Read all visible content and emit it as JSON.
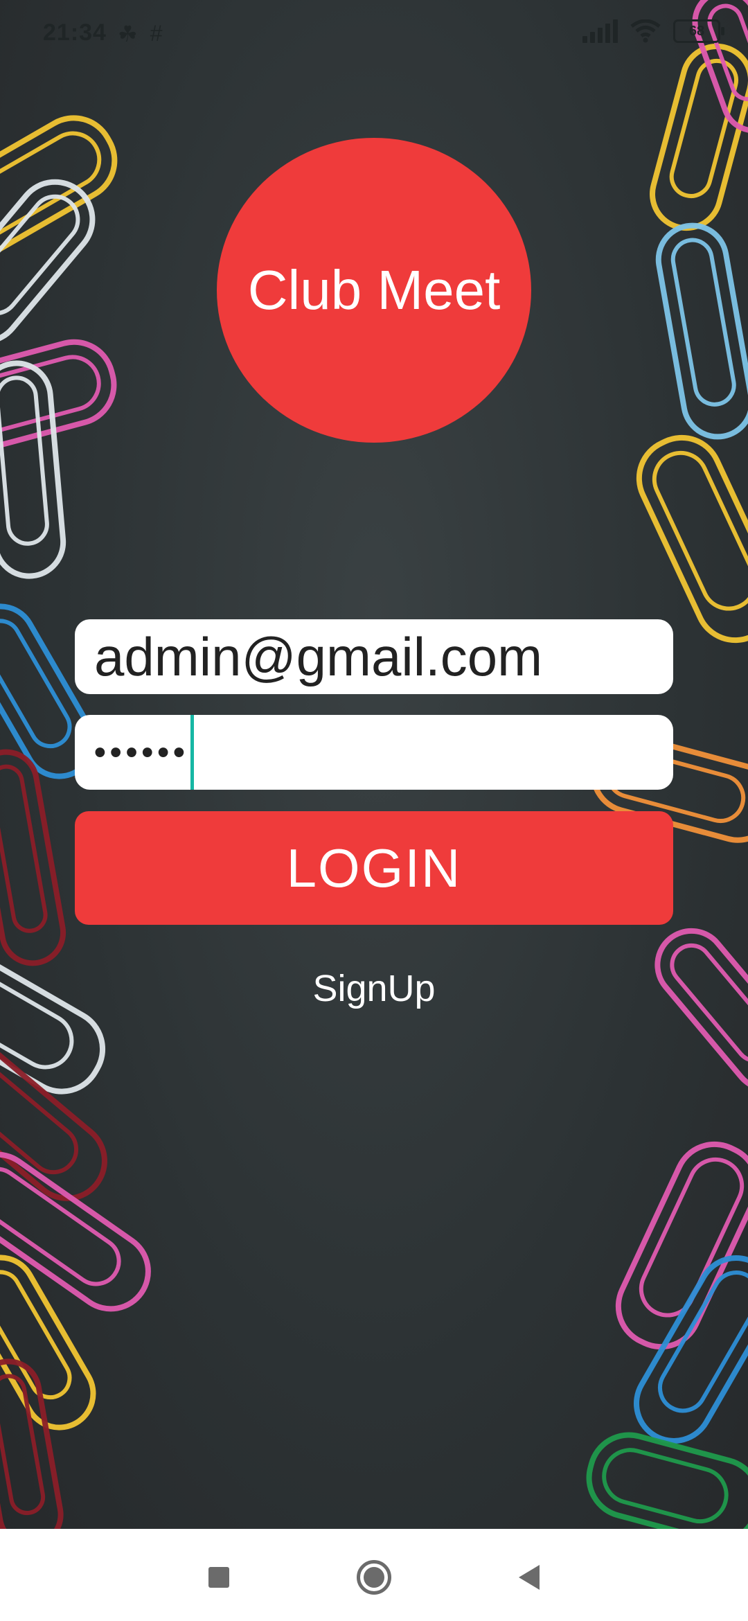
{
  "status_bar": {
    "time": "21:34",
    "battery": "68",
    "left_icons": [
      "plant-icon",
      "hash-grid-icon"
    ],
    "right_icons": [
      "signal-icon",
      "wifi-icon",
      "battery-icon"
    ]
  },
  "app": {
    "logo_text": "Club Meet"
  },
  "login_form": {
    "email_value": "admin@gmail.com",
    "password_masked": "••••••",
    "login_label": "LOGIN",
    "signup_label": "SignUp"
  },
  "nav_bar": {
    "buttons": [
      "recents-icon",
      "home-icon",
      "back-icon"
    ]
  },
  "colors": {
    "accent": "#ef3b3b",
    "background": "#2f3537",
    "caret": "#16b7a4"
  }
}
